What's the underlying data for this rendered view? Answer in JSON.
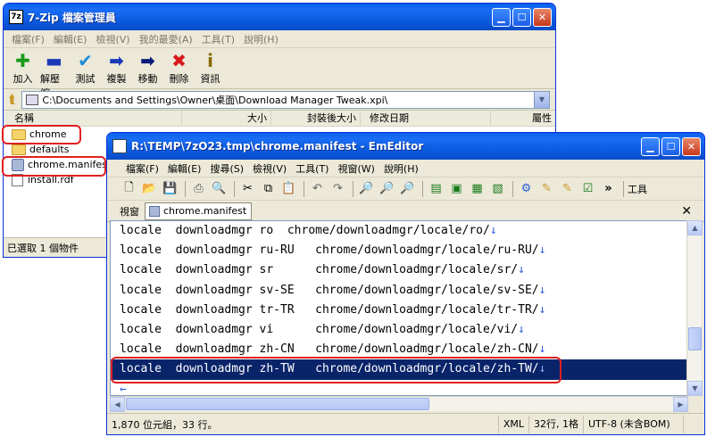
{
  "zip": {
    "title": "7-Zip 檔案管理員",
    "icon_text": "7z",
    "menu": [
      "檔案(F)",
      "編輯(E)",
      "檢視(V)",
      "我的最愛(A)",
      "工具(T)",
      "說明(H)"
    ],
    "toolbar": [
      {
        "icon": "plus-icon",
        "glyph": "✚",
        "label": "加入",
        "color": "#1a9a1a"
      },
      {
        "icon": "minus-icon",
        "glyph": "▬",
        "label": "解壓縮",
        "color": "#1a3ab8"
      },
      {
        "icon": "check-icon",
        "glyph": "✔",
        "label": "測試",
        "color": "#1d8ad9"
      },
      {
        "icon": "copy-arrow-icon",
        "glyph": "➡",
        "label": "複製",
        "color": "#1a3ab8"
      },
      {
        "icon": "move-arrow-icon",
        "glyph": "➡",
        "label": "移動",
        "color": "#0a1a7a"
      },
      {
        "icon": "delete-x-icon",
        "glyph": "✖",
        "label": "刪除",
        "color": "#d81a1a"
      },
      {
        "icon": "info-icon",
        "glyph": "i",
        "label": "資訊",
        "color": "#8a6a00"
      }
    ],
    "path": "C:\\Documents and Settings\\Owner\\桌面\\Download Manager Tweak.xpi\\",
    "columns": [
      "名稱",
      "大小",
      "封裝後大小",
      "修改日期",
      "屬性"
    ],
    "files": [
      {
        "name": "chrome",
        "kind": "folder"
      },
      {
        "name": "defaults",
        "kind": "folder"
      },
      {
        "name": "chrome.manifest",
        "kind": "manifest"
      },
      {
        "name": "install.rdf",
        "kind": "file"
      }
    ],
    "status": "已選取 1 個物件"
  },
  "em": {
    "title": "R:\\TEMP\\7zO23.tmp\\chrome.manifest - EmEditor",
    "menu": [
      "檔案(F)",
      "編輯(E)",
      "搜尋(S)",
      "檢視(V)",
      "工具(T)",
      "視窗(W)",
      "說明(H)"
    ],
    "tools_label": "工具",
    "tab_area_label": "視窗",
    "tab": "chrome.manifest",
    "lines": [
      "locale  downloadmgr ro  chrome/downloadmgr/locale/ro/",
      "locale  downloadmgr ru-RU   chrome/downloadmgr/locale/ru-RU/",
      "locale  downloadmgr sr      chrome/downloadmgr/locale/sr/",
      "locale  downloadmgr sv-SE   chrome/downloadmgr/locale/sv-SE/",
      "locale  downloadmgr tr-TR   chrome/downloadmgr/locale/tr-TR/",
      "locale  downloadmgr vi      chrome/downloadmgr/locale/vi/",
      "locale  downloadmgr zh-CN   chrome/downloadmgr/locale/zh-CN/",
      "locale  downloadmgr zh-TW   chrome/downloadmgr/locale/zh-TW/",
      ""
    ],
    "newline_mark": "↓",
    "eof_mark": "←",
    "selected_line": 7,
    "status": {
      "size": "1,870 位元組，33 行。",
      "mode": "XML",
      "position": "32行, 1格",
      "encoding": "UTF-8 (未含BOM)"
    }
  }
}
